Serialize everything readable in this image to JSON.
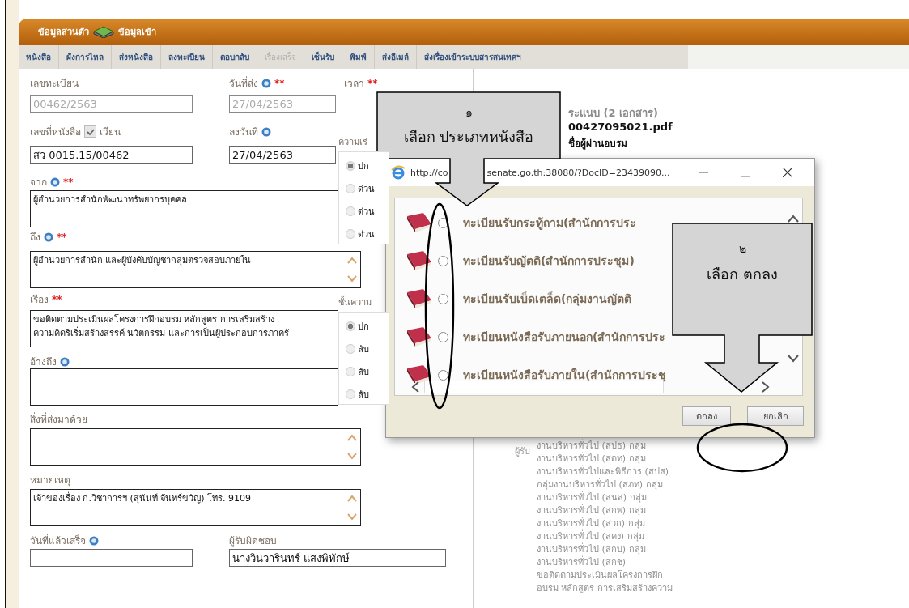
{
  "header": {
    "section": "ข้อมูลส่วนตัว",
    "title": "ข้อมูลเข้า"
  },
  "toolbar": [
    {
      "label": "หนังสือ",
      "disabled": false
    },
    {
      "label": "ผังการไหล",
      "disabled": false
    },
    {
      "label": "ส่งหนังสือ",
      "disabled": false
    },
    {
      "label": "ลงทะเบียน",
      "disabled": false
    },
    {
      "label": "ตอบกลับ",
      "disabled": false
    },
    {
      "label": "เรื่องเสร็จ",
      "disabled": true
    },
    {
      "label": "เซ็นรับ",
      "disabled": false
    },
    {
      "label": "พิมพ์",
      "disabled": false
    },
    {
      "label": "ส่งอีเมล์",
      "disabled": false
    },
    {
      "label": "ส่งเรื่องเข้าระบบสารสนเทศฯ",
      "disabled": false
    }
  ],
  "form": {
    "reg_no": {
      "label": "เลขทะเบียน",
      "value": "00462/2563",
      "disabled": true
    },
    "send_date": {
      "label": "วันที่ส่ง",
      "info": true,
      "required": "**",
      "value": "27/04/2563",
      "disabled": true
    },
    "time": {
      "label": "เวลา",
      "required": "**"
    },
    "doc_no": {
      "label": "เลขที่หนังสือ",
      "value": "สว 0015.15/00462"
    },
    "circular": {
      "label": "เวียน",
      "checked": true
    },
    "doc_date": {
      "label": "ลงวันที่",
      "info": true,
      "value": "27/04/2563"
    },
    "urgency": {
      "label": "ความเร่",
      "options": [
        {
          "label": "ปก",
          "selected": true
        },
        {
          "label": "ด่วน",
          "selected": false
        },
        {
          "label": "ด่วน",
          "selected": false
        },
        {
          "label": "ด่วน",
          "selected": false
        }
      ]
    },
    "from": {
      "label": "จาก",
      "info": true,
      "required": "**",
      "lines": [
        "ผู้อำนวยการสำนักพัฒนาทรัพยากรบุคคล"
      ]
    },
    "to": {
      "label": "ถึง",
      "info": true,
      "required": "**",
      "lines": [
        "ผู้อำนวยการสำนัก และผู้บังคับบัญชากลุ่มตรวจสอบภายใน"
      ],
      "scrollable": true
    },
    "subject": {
      "label": "เรื่อง",
      "required": "**",
      "lines": [
        "ขอติดตามประเมินผลโครงการฝึกอบรม หลักสูตร การเสริมสร้าง",
        "ความคิดริเริ่มสร้างสรรค์ นวัตกรรม และการเป็นผู้ประกอบการภาครั"
      ]
    },
    "classification": {
      "label": "ชั้นความ",
      "options": [
        {
          "label": "ปก",
          "selected": true
        },
        {
          "label": "ลับ",
          "selected": false
        },
        {
          "label": "ลับ",
          "selected": false
        },
        {
          "label": "ลับ",
          "selected": false
        }
      ]
    },
    "reference": {
      "label": "อ้างถึง",
      "info": true
    },
    "enclosure": {
      "label": "สิ่งที่ส่งมาด้วย",
      "scrollable": true
    },
    "note": {
      "label": "หมายเหตุ",
      "lines": [
        "เจ้าของเรื่อง ก.วิชาการฯ (สุนันท์  จันทร์ขวัญ) โทร. 9109"
      ],
      "scrollable": true
    },
    "done_date": {
      "label": "วันที่แล้วเสร็จ",
      "info": true
    },
    "owner": {
      "label": "ผู้รับผิดชอบ",
      "value": "นางวินวารินทร์ แสงพิทักษ์"
    }
  },
  "details": {
    "attachments_heading": "ระแนบ (2 เอกสาร)",
    "file_name": "00427095021.pdf",
    "file_note": "ชื่อผู้ผ่านอบรม",
    "recipients_label": "ผู้รับ",
    "recipients": [
      "งานบริหารทั่วไป (สปธ) กลุ่ม",
      "งานบริหารทั่วไป (สดท) กลุ่ม",
      "งานบริหารทั่วไปและพิธีการ (สปส)",
      "กลุ่มงานบริหารทั่วไป (สภท) กลุ่ม",
      "งานบริหารทั่วไป (สนส) กลุ่ม",
      "งานบริหารทั่วไป (สกพ) กลุ่ม",
      "งานบริหารทั่วไป (สวก) กลุ่ม",
      "งานบริหารทั่วไป (สคง) กลุ่ม",
      "งานบริหารทั่วไป (สกบ) กลุ่ม",
      "งานบริหารทั่วไป (สกช)"
    ],
    "subject_lines": [
      "ขอติดตามประเมินผลโครงการฝึก",
      "อบรม หลักสูตร การเสริมสร้างความ"
    ]
  },
  "dialog": {
    "title_parts": [
      "http://co",
      "senate.go.th:38080/?DocID=23439090..."
    ],
    "options": [
      {
        "label": "ทะเบียนรับกระทู้ถาม(สำนักการประ",
        "selected": false
      },
      {
        "label": "ทะเบียนรับญัตติ(สำนักการประชุม)",
        "selected": false
      },
      {
        "label": "ทะเบียนรับเบ็ดเตล็ด(กลุ่มงานญัตติ",
        "selected": false
      },
      {
        "label": "ทะเบียนหนังสือรับภายนอก(สำนักการประ",
        "selected": false
      },
      {
        "label": "ทะเบียนหนังสือรับภายใน(สำนักการประชุ",
        "selected": false
      }
    ],
    "buttons": [
      "ตกลง",
      "ยกเลิก"
    ]
  },
  "callouts": [
    {
      "number": "๑",
      "text": "เลือก ประเภทหนังสือ"
    },
    {
      "number": "๒",
      "text": "เลือก ตกลง"
    }
  ]
}
